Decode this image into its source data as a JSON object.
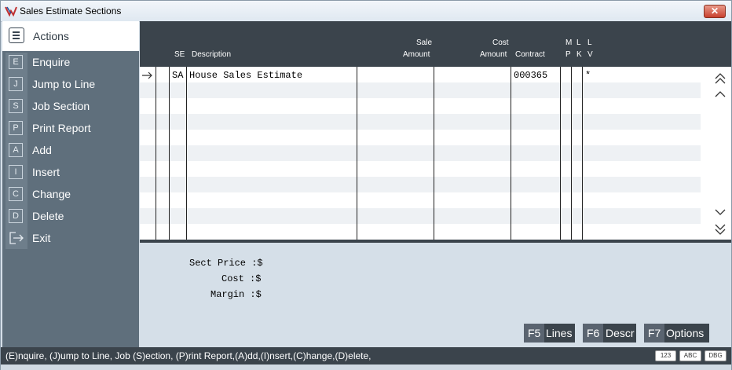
{
  "window": {
    "title": "Sales Estimate Sections",
    "close_label": "✕"
  },
  "sidebar": {
    "header": "Actions",
    "items": [
      {
        "key": "E",
        "label": "Enquire"
      },
      {
        "key": "J",
        "label": "Jump to Line"
      },
      {
        "key": "S",
        "label": "Job Section"
      },
      {
        "key": "P",
        "label": "Print Report"
      },
      {
        "key": "A",
        "label": "Add"
      },
      {
        "key": "I",
        "label": "Insert"
      },
      {
        "key": "C",
        "label": "Change"
      },
      {
        "key": "D",
        "label": "Delete"
      },
      {
        "key": "",
        "label": "Exit"
      }
    ]
  },
  "grid": {
    "headers": {
      "se": "SE",
      "description": "Description",
      "sale_1": "Sale",
      "sale_2": "Amount",
      "cost_1": "Cost",
      "cost_2": "Amount",
      "contract": "Contract",
      "mp_1": "M",
      "mp_2": "P",
      "lk_1": "L",
      "lk_2": "K",
      "lv_1": "L",
      "lv_2": "V"
    },
    "rows": [
      {
        "se": "SA",
        "description": "House Sales Estimate",
        "sale": "",
        "cost": "",
        "contract": "000365",
        "mp": "",
        "lk": "",
        "lv": "*"
      }
    ]
  },
  "totals": {
    "sect_price_label": "Sect Price :$",
    "cost_label": "Cost :$",
    "margin_label": "Margin :$"
  },
  "function_keys": [
    {
      "key": "F5",
      "label": "Lines"
    },
    {
      "key": "F6",
      "label": "Descr"
    },
    {
      "key": "F7",
      "label": "Options"
    }
  ],
  "status": {
    "hint": "(E)nquire, (J)ump to Line, Job (S)ection, (P)rint Report,(A)dd,(I)nsert,(C)hange,(D)elete,",
    "badges": [
      "123",
      "ABC",
      "DBG"
    ]
  }
}
